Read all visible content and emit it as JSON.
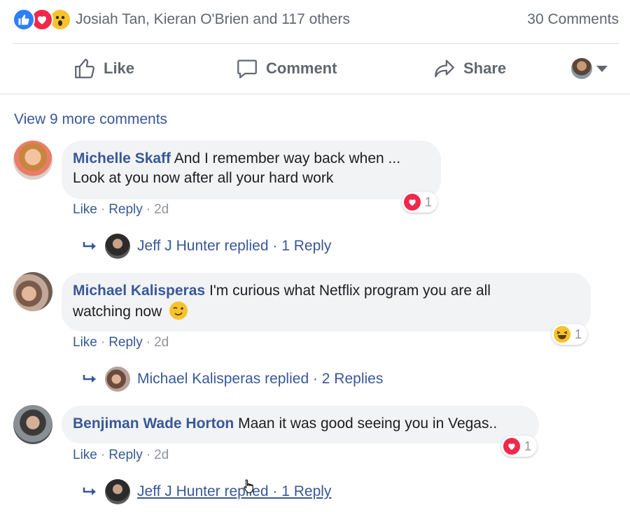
{
  "summary": {
    "names": "Josiah Tan, Kieran O'Brien and 117 others",
    "comments": "30 Comments",
    "reactions": [
      "like-icon",
      "love-icon",
      "wow-icon"
    ]
  },
  "actions": {
    "like": "Like",
    "comment": "Comment",
    "share": "Share"
  },
  "view_more": "View 9 more comments",
  "comments": [
    {
      "author": "Michelle Skaff",
      "text_line1": "And I remember way back when ...",
      "text_line2": "Look at you now after all your hard work",
      "reaction_icon": "love-icon",
      "reaction_count": "1",
      "like": "Like",
      "reply": "Reply",
      "time": "2d",
      "reply_summary": "Jeff J Hunter replied · 1 Reply"
    },
    {
      "author": "Michael Kalisperas",
      "text_line1": "I'm curious what Netflix program you are all",
      "text_line2": "watching now",
      "reaction_icon": "haha-icon",
      "reaction_count": "1",
      "like": "Like",
      "reply": "Reply",
      "time": "2d",
      "reply_summary": "Michael Kalisperas replied · 2 Replies"
    },
    {
      "author": "Benjiman Wade Horton",
      "text_line1": "Maan it was good seeing you in Vegas..",
      "reaction_icon": "love-icon",
      "reaction_count": "1",
      "like": "Like",
      "reply": "Reply",
      "time": "2d",
      "reply_summary": "Jeff J Hunter replied · 1 Reply"
    }
  ],
  "colors": {
    "link": "#385898",
    "secondary_text": "#606770",
    "bubble": "#f2f3f5",
    "like_blue": "#2d7ff9",
    "love_red": "#f0284a",
    "wow_yellow": "#f7c32c"
  }
}
